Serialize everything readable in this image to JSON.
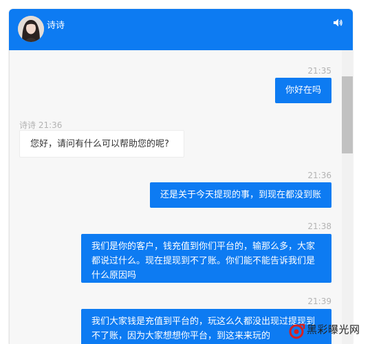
{
  "header": {
    "contact_name": "诗诗",
    "avatar_icon": "avatar-image",
    "sound_icon": "volume-icon",
    "color": "#0d7bf2"
  },
  "messages": [
    {
      "direction": "out",
      "time": "21:35",
      "text": "你好在吗"
    },
    {
      "direction": "in",
      "sender_time": "诗诗 21:36",
      "text": "您好，请问有什么可以帮助您的呢?"
    },
    {
      "direction": "out",
      "time": "21:36",
      "text": "还是关于今天提现的事，到现在都没到账"
    },
    {
      "direction": "out",
      "time": "21:38",
      "text": "我们是你的客户，钱充值到你们平台的，输那么多，大家都说过什么。现在提现到不了账。你们能不能告诉我们是什么原因吗"
    },
    {
      "direction": "out",
      "time": "21:39",
      "text": "我们大家钱是充值到平台的，玩这么久都没出现过提现到不了账，因为大家想想你平台，到这来来玩的"
    }
  ],
  "watermark": {
    "text": "黑彩曝光网"
  }
}
